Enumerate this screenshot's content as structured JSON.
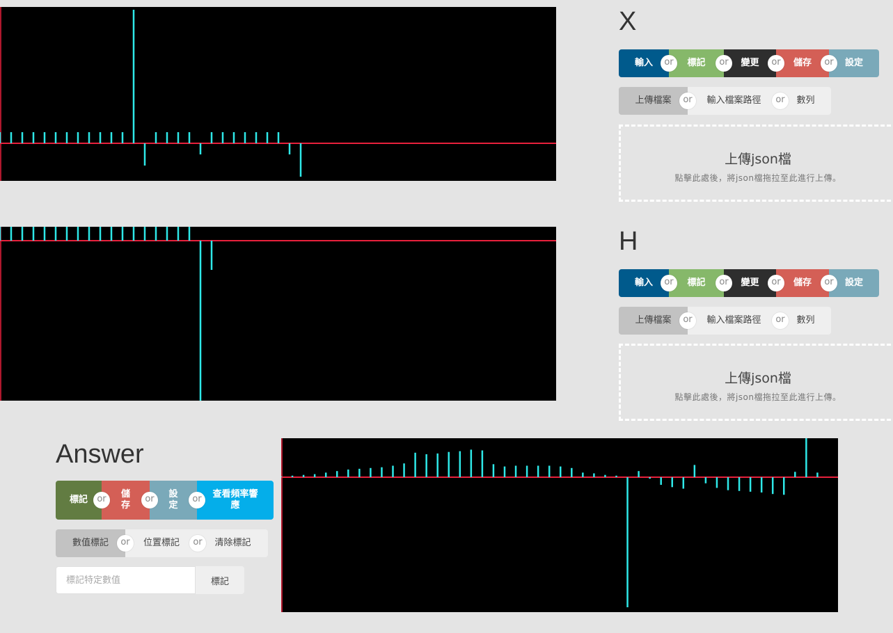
{
  "x_panel": {
    "title": "X",
    "toolbar": [
      "輸入",
      "標記",
      "變更",
      "儲存",
      "設定"
    ],
    "sub_toolbar": [
      "上傳檔案",
      "輸入檔案路徑",
      "數列"
    ],
    "dropzone": {
      "title": "上傳json檔",
      "hint": "點擊此處後，將json檔拖拉至此進行上傳。"
    }
  },
  "h_panel": {
    "title": "H",
    "toolbar": [
      "輸入",
      "標記",
      "變更",
      "儲存",
      "設定"
    ],
    "sub_toolbar": [
      "上傳檔案",
      "輸入檔案路徑",
      "數列"
    ],
    "dropzone": {
      "title": "上傳json檔",
      "hint": "點擊此處後，將json檔拖拉至此進行上傳。"
    }
  },
  "answer_panel": {
    "title": "Answer",
    "toolbar": [
      "標記",
      "儲存",
      "設定",
      "查看頻率響應"
    ],
    "sub_toolbar": [
      "數值標記",
      "位置標記",
      "清除標記"
    ],
    "mark_input_placeholder": "標記特定數值",
    "mark_button": "標記"
  },
  "or_label": "or",
  "colors": {
    "toolbar": [
      "#005a8c",
      "#86b86a",
      "#2e2e2e",
      "#d45f56",
      "#7aa9b9"
    ],
    "answer_toolbar": [
      "#627c42",
      "#d45f56",
      "#7aa9b9",
      "#04aeea"
    ],
    "stem": "#2ee8e8",
    "axis": "#e8203c",
    "canvas_bg": "#000000"
  },
  "signals": {
    "x": [
      1,
      1,
      1,
      1,
      1,
      1,
      1,
      1,
      1,
      1,
      1,
      1,
      12,
      -2,
      1,
      1,
      1,
      1,
      -1,
      1,
      1,
      1,
      1,
      1,
      1,
      1,
      -1,
      -3
    ],
    "h": [
      1,
      1,
      1,
      1,
      1,
      1,
      1,
      1,
      1,
      1,
      1,
      1,
      1,
      1,
      1,
      1,
      1,
      1,
      -11,
      -2
    ],
    "answer": [
      0.1,
      0.2,
      0.3,
      0.4,
      0.6,
      0.8,
      1,
      1.1,
      1.2,
      1.3,
      1.5,
      1.8,
      3.2,
      3,
      3.1,
      3.3,
      3.4,
      3.6,
      3.5,
      1.7,
      1.4,
      1.5,
      1.5,
      1.5,
      1.5,
      1.4,
      1.2,
      0.6,
      0.5,
      0.3,
      0.2,
      -17,
      0.8,
      -0.2,
      -1,
      -1.3,
      -1.5,
      1.6,
      -0.8,
      -1.4,
      -1.7,
      -1.8,
      -1.9,
      -2,
      -2.2,
      -2.3,
      0.7,
      5.1,
      0.6
    ]
  }
}
